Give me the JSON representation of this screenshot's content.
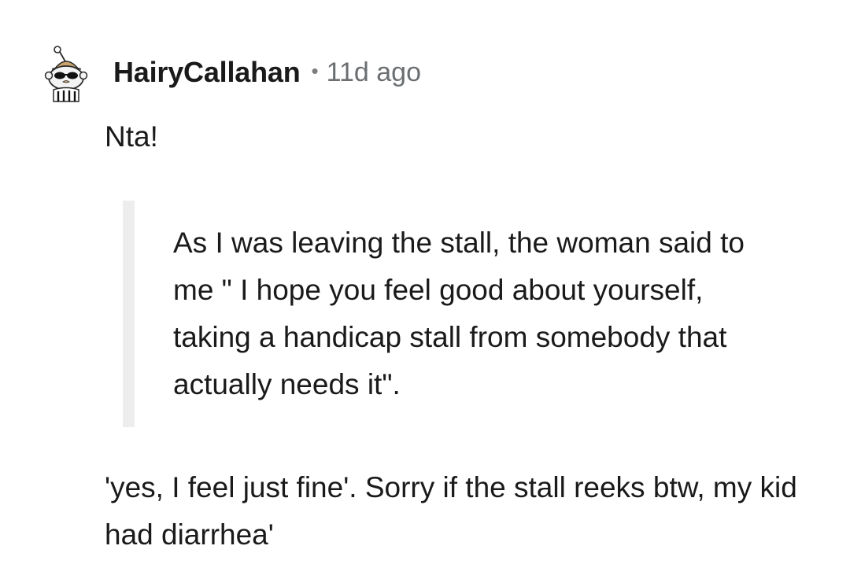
{
  "comment": {
    "author": "HairyCallahan",
    "separator": "•",
    "timestamp": "11d ago",
    "paragraphs": {
      "first": "Nta!",
      "quote": "As I was leaving the stall, the woman said to me \" I hope you feel good about yourself, taking a handicap stall from somebody that actually needs it\".",
      "last": "'yes, I feel just fine'. Sorry if the stall reeks btw, my kid had diarrhea'"
    }
  },
  "avatar": {
    "icon": "snoo-avatar-with-sunglasses",
    "colors": {
      "face": "#f3f3f3",
      "sunglasses": "#111111",
      "hat": "#c8a26a",
      "outline": "#2b2b2b"
    }
  }
}
